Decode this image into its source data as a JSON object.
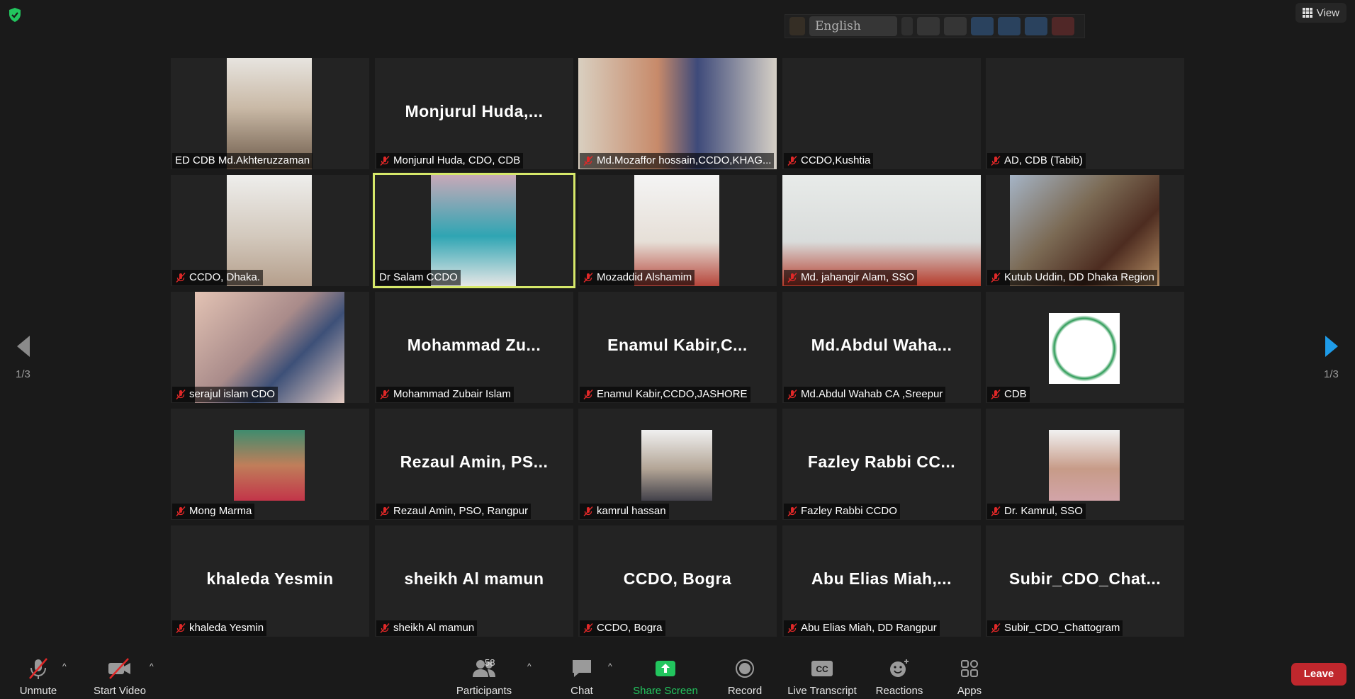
{
  "top": {
    "view_label": "View"
  },
  "language_bar": {
    "selected_language": "English"
  },
  "gallery": {
    "page_left": "1/3",
    "page_right": "1/3",
    "tiles": [
      {
        "label": "ED CDB Md.Akhteruzzaman",
        "big_name": "",
        "muted": false
      },
      {
        "label": "Monjurul Huda, CDO, CDB",
        "big_name": "Monjurul Huda,...",
        "muted": true
      },
      {
        "label": "Md.Mozaffor hossain,CCDO,KHAG...",
        "big_name": "",
        "muted": true
      },
      {
        "label": "CCDO,Kushtia",
        "big_name": "",
        "muted": true
      },
      {
        "label": "AD, CDB (Tabib)",
        "big_name": "",
        "muted": true
      },
      {
        "label": "CCDO, Dhaka.",
        "big_name": "",
        "muted": true
      },
      {
        "label": "Dr Salam CCDO",
        "big_name": "",
        "muted": false
      },
      {
        "label": "Mozaddid Alshamim",
        "big_name": "",
        "muted": true
      },
      {
        "label": "Md. jahangir Alam, SSO",
        "big_name": "",
        "muted": true
      },
      {
        "label": "Kutub Uddin, DD Dhaka Region",
        "big_name": "",
        "muted": true
      },
      {
        "label": "serajul islam CDO",
        "big_name": "",
        "muted": true
      },
      {
        "label": "Mohammad Zubair Islam",
        "big_name": "Mohammad Zu...",
        "muted": true
      },
      {
        "label": "Enamul Kabir,CCDO,JASHORE",
        "big_name": "Enamul Kabir,C...",
        "muted": true
      },
      {
        "label": "Md.Abdul Wahab CA ,Sreepur",
        "big_name": "Md.Abdul Waha...",
        "muted": true
      },
      {
        "label": "CDB",
        "big_name": "",
        "muted": true
      },
      {
        "label": "Mong Marma",
        "big_name": "",
        "muted": true
      },
      {
        "label": "Rezaul Amin, PSO, Rangpur",
        "big_name": "Rezaul Amin, PS...",
        "muted": true
      },
      {
        "label": "kamrul hassan",
        "big_name": "",
        "muted": true
      },
      {
        "label": "Fazley Rabbi CCDO",
        "big_name": "Fazley Rabbi CC...",
        "muted": true
      },
      {
        "label": "Dr. Kamrul, SSO",
        "big_name": "",
        "muted": true
      },
      {
        "label": "khaleda Yesmin",
        "big_name": "khaleda Yesmin",
        "muted": true
      },
      {
        "label": "sheikh Al mamun",
        "big_name": "sheikh Al mamun",
        "muted": true
      },
      {
        "label": "CCDO, Bogra",
        "big_name": "CCDO, Bogra",
        "muted": true
      },
      {
        "label": "Abu Elias Miah, DD Rangpur",
        "big_name": "Abu Elias Miah,...",
        "muted": true
      },
      {
        "label": "Subir_CDO_Chattogram",
        "big_name": "Subir_CDO_Chat...",
        "muted": true
      }
    ]
  },
  "toolbar": {
    "unmute": "Unmute",
    "start_video": "Start Video",
    "participants": "Participants",
    "participant_count": "58",
    "chat": "Chat",
    "share_screen": "Share Screen",
    "record": "Record",
    "live_transcript": "Live Transcript",
    "reactions": "Reactions",
    "apps": "Apps",
    "leave": "Leave"
  },
  "colors": {
    "active_speaker": "#d6e86a",
    "share_green": "#22c55e",
    "leave_red": "#c0272d",
    "muted_red": "#e02828"
  }
}
